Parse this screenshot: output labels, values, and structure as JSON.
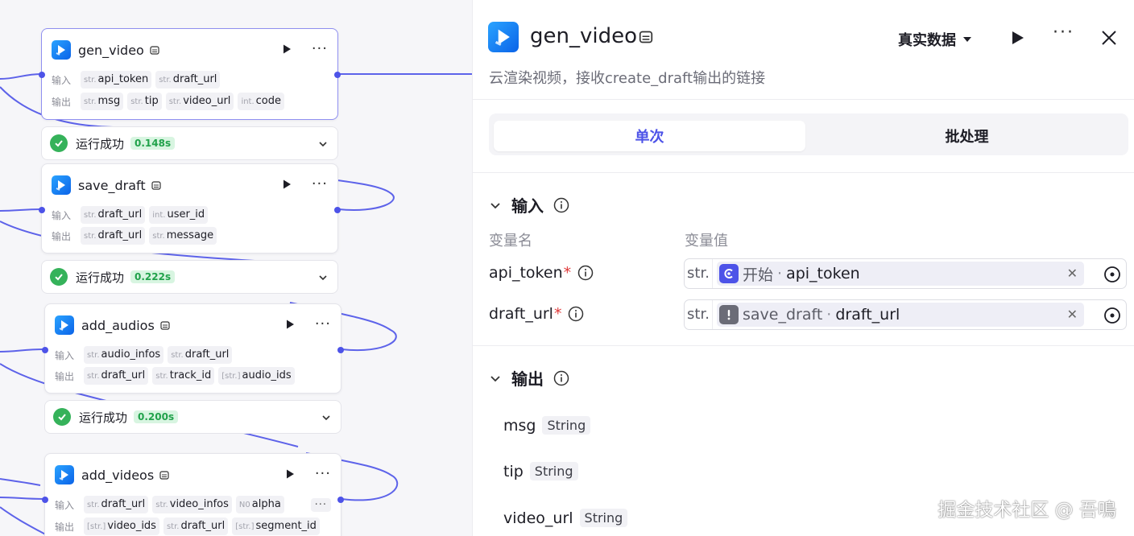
{
  "canvas": {
    "nodes": [
      {
        "title": "gen_video",
        "input_label": "输入",
        "output_label": "输出",
        "inputs": [
          {
            "type": "str.",
            "name": "api_token"
          },
          {
            "type": "str.",
            "name": "draft_url"
          }
        ],
        "outputs": [
          {
            "type": "str.",
            "name": "msg"
          },
          {
            "type": "str.",
            "name": "tip"
          },
          {
            "type": "str.",
            "name": "video_url"
          },
          {
            "type": "int.",
            "name": "code"
          }
        ],
        "status": {
          "text": "运行成功",
          "time": "0.148s"
        }
      },
      {
        "title": "save_draft",
        "input_label": "输入",
        "output_label": "输出",
        "inputs": [
          {
            "type": "str.",
            "name": "draft_url"
          },
          {
            "type": "int.",
            "name": "user_id"
          }
        ],
        "outputs": [
          {
            "type": "str.",
            "name": "draft_url"
          },
          {
            "type": "str.",
            "name": "message"
          }
        ],
        "status": {
          "text": "运行成功",
          "time": "0.222s"
        }
      },
      {
        "title": "add_audios",
        "input_label": "输入",
        "output_label": "输出",
        "inputs": [
          {
            "type": "str.",
            "name": "audio_infos"
          },
          {
            "type": "str.",
            "name": "draft_url"
          }
        ],
        "outputs": [
          {
            "type": "str.",
            "name": "draft_url"
          },
          {
            "type": "str.",
            "name": "track_id"
          },
          {
            "type": "[str.]",
            "name": "audio_ids"
          }
        ],
        "status": {
          "text": "运行成功",
          "time": "0.200s"
        }
      },
      {
        "title": "add_videos",
        "input_label": "输入",
        "output_label": "输出",
        "inputs": [
          {
            "type": "str.",
            "name": "draft_url"
          },
          {
            "type": "str.",
            "name": "video_infos"
          },
          {
            "type": "N0",
            "name": "alpha"
          }
        ],
        "outputs": [
          {
            "type": "[str.]",
            "name": "video_ids"
          },
          {
            "type": "str.",
            "name": "draft_url"
          },
          {
            "type": "[str.]",
            "name": "segment_id"
          }
        ],
        "more": "···"
      }
    ]
  },
  "panel": {
    "title": "gen_video",
    "mode": "真实数据",
    "description": "云渲染视频，接收create_draft输出的链接",
    "tabs": {
      "single": "单次",
      "batch": "批处理"
    },
    "input": {
      "heading": "输入",
      "col_name": "变量名",
      "col_value": "变量值",
      "vars": [
        {
          "name": "api_token",
          "required": "*",
          "type": "str.",
          "source_node": "开始",
          "sep": "·",
          "source_var": "api_token",
          "icon": "start-node-icon",
          "icon_color": "#4d53e8"
        },
        {
          "name": "draft_url",
          "required": "*",
          "type": "str.",
          "source_node": "save_draft",
          "sep": "·",
          "source_var": "draft_url",
          "icon": "warning-icon",
          "icon_color": "#6b6c77"
        }
      ]
    },
    "output": {
      "heading": "输出",
      "vars": [
        {
          "name": "msg",
          "type": "String"
        },
        {
          "name": "tip",
          "type": "String"
        },
        {
          "name": "video_url",
          "type": "String"
        }
      ]
    }
  },
  "watermark": "掘金技术社区 @ 吾鳴",
  "colors": {
    "accent": "#4d53e8",
    "success": "#35b25a",
    "required": "#e03a3a",
    "plugin_logo": "#0b63e8"
  }
}
